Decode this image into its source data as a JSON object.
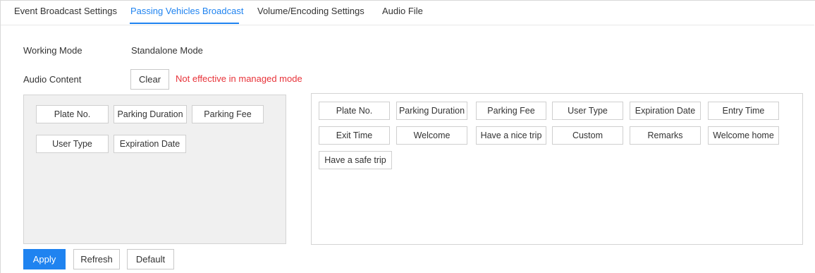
{
  "tabs": [
    {
      "label": "Event Broadcast Settings",
      "active": false
    },
    {
      "label": "Passing Vehicles Broadcast",
      "active": true
    },
    {
      "label": "Volume/Encoding Settings",
      "active": false
    },
    {
      "label": "Audio File",
      "active": false
    }
  ],
  "form": {
    "working_mode_label": "Working Mode",
    "working_mode_value": "Standalone Mode",
    "audio_content_label": "Audio Content",
    "clear_label": "Clear",
    "warning": "Not effective in managed mode"
  },
  "selected_items": [
    "Plate No.",
    "Parking Duration",
    "Parking Fee",
    "User Type",
    "Expiration Date"
  ],
  "available_items": [
    "Plate No.",
    "Parking Duration",
    "Parking Fee",
    "User Type",
    "Expiration Date",
    "Entry Time",
    "Exit Time",
    "Welcome",
    "Have a nice trip",
    "Custom",
    "Remarks",
    "Welcome home",
    "Have a safe trip"
  ],
  "footer": {
    "apply_label": "Apply",
    "refresh_label": "Refresh",
    "default_label": "Default"
  },
  "colors": {
    "accent": "#1f83f0",
    "warning": "#e8333a",
    "panel_bg": "#f0f0f0"
  }
}
